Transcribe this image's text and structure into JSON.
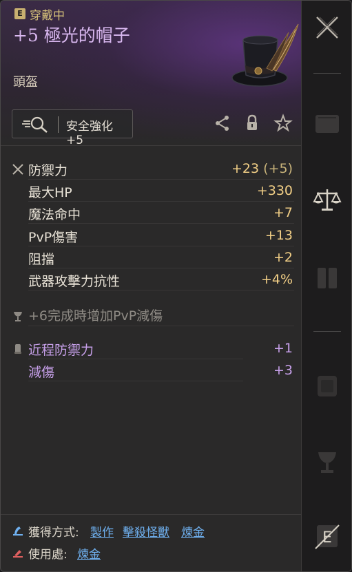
{
  "header": {
    "equip_badge": "E",
    "equip_status": "穿戴中",
    "item_name": "+5 極光的帽子",
    "item_type": "頭盔",
    "upgrade_label": "安全強化 +5"
  },
  "stats": [
    {
      "name": "防禦力",
      "value": "+23",
      "bonus": "(+5)",
      "icon": "crossed-swords-icon"
    },
    {
      "name": "最大HP",
      "value": "+330",
      "bonus": ""
    },
    {
      "name": "魔法命中",
      "value": "+7",
      "bonus": ""
    },
    {
      "name": "PvP傷害",
      "value": "+13",
      "bonus": ""
    },
    {
      "name": "阻擋",
      "value": "+2",
      "bonus": ""
    },
    {
      "name": "武器攻擊力抗性",
      "value": "+4%",
      "bonus": ""
    }
  ],
  "set_bonus": "+6完成時增加PvP減傷",
  "special_stats": [
    {
      "name": "近程防禦力",
      "value": "+1"
    },
    {
      "name": "減傷",
      "value": "+3"
    }
  ],
  "acquisition": {
    "label": "獲得方式:",
    "links": [
      "製作",
      "擊殺怪獸",
      "煉金"
    ]
  },
  "usage": {
    "label": "使用處:",
    "links": [
      "煉金"
    ]
  },
  "colors": {
    "accent_purple": "#c7a0ea",
    "stat_gold": "#f2cf86",
    "link_blue": "#6fb0ef"
  }
}
